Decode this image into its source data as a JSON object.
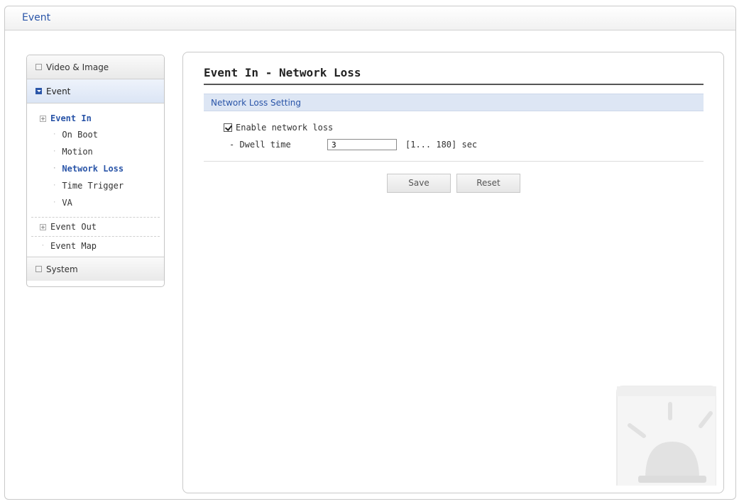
{
  "window": {
    "title": "Event"
  },
  "sidebar": {
    "sections": {
      "video_image": "Video & Image",
      "event": "Event",
      "system": "System"
    },
    "event_in": {
      "label": "Event In",
      "items": [
        "On Boot",
        "Motion",
        "Network Loss",
        "Time Trigger",
        "VA"
      ],
      "current": "Network Loss"
    },
    "event_out": "Event Out",
    "event_map": "Event Map"
  },
  "main": {
    "title": "Event In - Network Loss",
    "section_title": "Network Loss Setting",
    "enable_label": "Enable network loss",
    "enable_checked": true,
    "dwell_label": "- Dwell time",
    "dwell_value": "3",
    "dwell_range": "[1... 180] sec",
    "save_label": "Save",
    "reset_label": "Reset"
  },
  "colors": {
    "accent": "#2a55a8",
    "section_bar": "#dde6f4"
  }
}
